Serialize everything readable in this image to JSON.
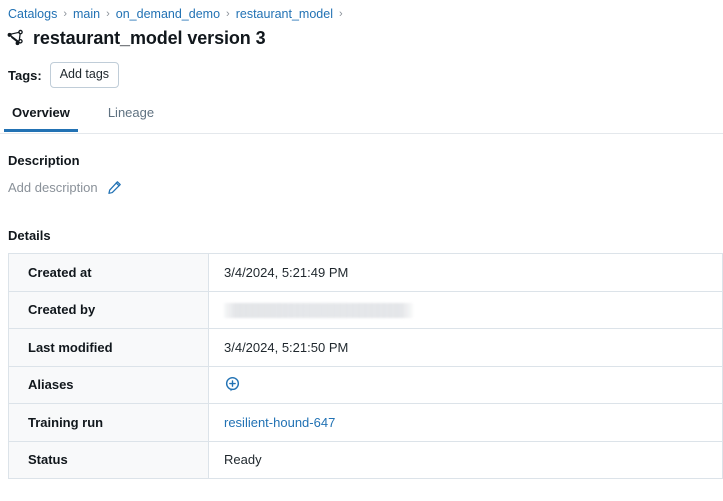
{
  "breadcrumb": {
    "separator": "›",
    "items": [
      {
        "label": "Catalogs"
      },
      {
        "label": "main"
      },
      {
        "label": "on_demand_demo"
      },
      {
        "label": "restaurant_model"
      }
    ],
    "trailing_separator": "›"
  },
  "header": {
    "icon": "model-graph-icon",
    "title": "restaurant_model version 3"
  },
  "tags": {
    "label": "Tags:",
    "add_button": "Add tags"
  },
  "tabs": [
    {
      "label": "Overview",
      "active": true
    },
    {
      "label": "Lineage",
      "active": false
    }
  ],
  "description": {
    "heading": "Description",
    "placeholder": "Add description",
    "edit_icon": "pencil-edit-icon"
  },
  "details": {
    "heading": "Details",
    "rows": [
      {
        "key": "Created at",
        "value": "3/4/2024, 5:21:49 PM",
        "type": "text"
      },
      {
        "key": "Created by",
        "value": "",
        "type": "redacted"
      },
      {
        "key": "Last modified",
        "value": "3/4/2024, 5:21:50 PM",
        "type": "text"
      },
      {
        "key": "Aliases",
        "value": "",
        "type": "icon",
        "icon": "add-alias-bubble-icon"
      },
      {
        "key": "Training run",
        "value": "resilient-hound-647",
        "type": "link"
      },
      {
        "key": "Status",
        "value": "Ready",
        "type": "text"
      }
    ]
  },
  "colors": {
    "link": "#2272b4",
    "accent": "#2272b4",
    "text": "#1f272d",
    "muted": "#8a9199",
    "border": "#dce3e9",
    "row_key_bg": "#f8f9fa"
  }
}
